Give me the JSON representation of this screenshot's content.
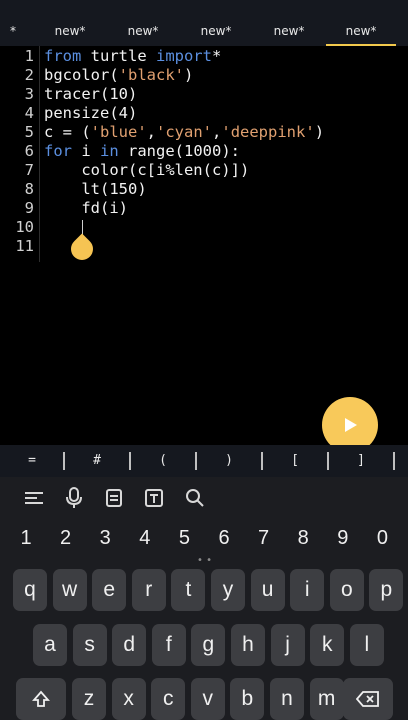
{
  "tabs": {
    "first_marker": "*",
    "items": [
      "new*",
      "new*",
      "new*",
      "new*",
      "new*"
    ],
    "active_index": 4,
    "accent_color": "#f2c94c"
  },
  "editor": {
    "line_numbers": [
      "1",
      "2",
      "3",
      "4",
      "5",
      "6",
      "7",
      "8",
      "9",
      "10",
      "11"
    ],
    "lines": [
      [
        {
          "t": "kw",
          "v": "from"
        },
        {
          "t": "",
          "v": " turtle "
        },
        {
          "t": "kw",
          "v": "import"
        },
        {
          "t": "",
          "v": "*"
        }
      ],
      [
        {
          "t": "",
          "v": "bgcolor("
        },
        {
          "t": "str",
          "v": "'black'"
        },
        {
          "t": "",
          "v": ")"
        }
      ],
      [
        {
          "t": "",
          "v": "tracer(10)"
        }
      ],
      [
        {
          "t": "",
          "v": "pensize(4)"
        }
      ],
      [
        {
          "t": "",
          "v": "c = ("
        },
        {
          "t": "str",
          "v": "'blue'"
        },
        {
          "t": "",
          "v": ","
        },
        {
          "t": "str",
          "v": "'cyan'"
        },
        {
          "t": "",
          "v": ","
        },
        {
          "t": "str",
          "v": "'deeppink'"
        },
        {
          "t": "",
          "v": ")"
        }
      ],
      [
        {
          "t": "kw",
          "v": "for"
        },
        {
          "t": "",
          "v": " i "
        },
        {
          "t": "kw",
          "v": "in"
        },
        {
          "t": "",
          "v": " range(1000):"
        }
      ],
      [
        {
          "t": "",
          "v": "    color(c[i%len(c)])"
        }
      ],
      [
        {
          "t": "",
          "v": "    lt(150)"
        }
      ],
      [
        {
          "t": "",
          "v": "    fd(i)"
        }
      ],
      [],
      []
    ]
  },
  "run_button": {
    "icon": "play-icon"
  },
  "symbols": [
    "=",
    "#",
    "(",
    ")",
    "[",
    "]"
  ],
  "keyboard": {
    "tools": [
      "menu-icon",
      "microphone-icon",
      "clipboard-icon",
      "text-format-icon",
      "search-icon"
    ],
    "numbers": [
      "1",
      "2",
      "3",
      "4",
      "5",
      "6",
      "7",
      "8",
      "9",
      "0"
    ],
    "row1": [
      "q",
      "w",
      "e",
      "r",
      "t",
      "y",
      "u",
      "i",
      "o",
      "p"
    ],
    "row2": [
      "a",
      "s",
      "d",
      "f",
      "g",
      "h",
      "j",
      "k",
      "l"
    ],
    "row3": [
      "z",
      "x",
      "c",
      "v",
      "b",
      "n",
      "m"
    ],
    "shift_icon": "shift-icon",
    "backspace_icon": "backspace-icon"
  }
}
